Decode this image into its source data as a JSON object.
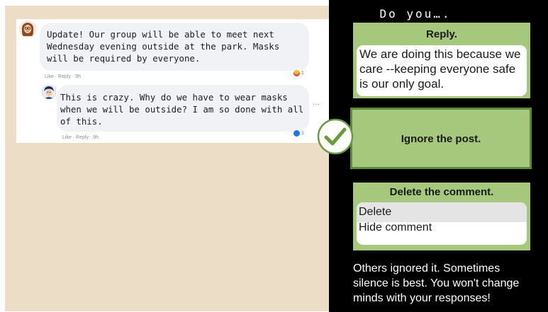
{
  "heading": "Do you….",
  "post": {
    "author_avatar": "avatar-bitmoji-woman",
    "text": "Update! Our group will be able to meet next Wednesday evening outside at the park. Masks will be required by everyone.",
    "meta": "Like · Reply · 9h",
    "reaction": {
      "icon": "haha-emoji-icon",
      "count": "1"
    }
  },
  "comment": {
    "author_avatar": "avatar-bitmoji-man",
    "text": "This is crazy. Why do we have to wear masks when we will be outside? I am so done with all of this.",
    "meta": "Like · Reply · 9h",
    "more": "···",
    "reaction": {
      "icon": "like-icon",
      "count": "1"
    }
  },
  "options": {
    "reply": {
      "title": "Reply.",
      "text": "We are doing this because we care --keeping everyone safe is our only goal."
    },
    "ignore": {
      "title": "Ignore the post.",
      "selected": true
    },
    "delete": {
      "title": "Delete the comment.",
      "menu": [
        "Delete",
        "Hide comment"
      ]
    }
  },
  "feedback": "Others ignored it. Sometimes silence is best. You won't change minds with your responses!",
  "colors": {
    "option_green": "#a5c87c",
    "check_green": "#6a9a3e",
    "left_background": "#ecdec6",
    "right_background": "#000000"
  }
}
